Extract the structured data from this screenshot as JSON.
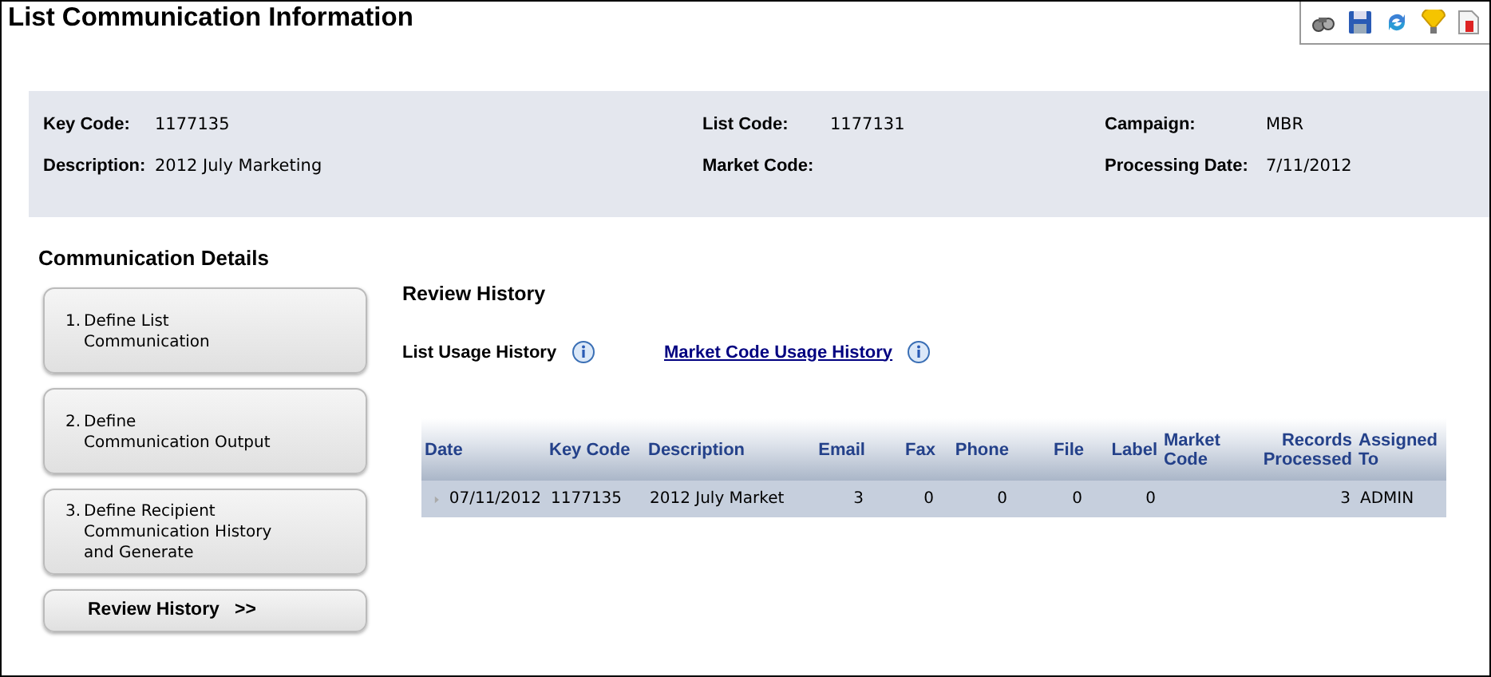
{
  "window": {
    "title": "List Communication Information"
  },
  "toolbar": [
    {
      "kind": "binoculars"
    },
    {
      "kind": "save"
    },
    {
      "kind": "refresh"
    },
    {
      "kind": "bulb"
    },
    {
      "kind": "report"
    }
  ],
  "info": [
    {
      "label": "Key Code:",
      "value": "1177135"
    },
    {
      "label": "List Code:",
      "value": "1177131"
    },
    {
      "label": "Campaign:",
      "value": "MBR"
    },
    {
      "label": "Description:",
      "value": "2012 July Marketing"
    },
    {
      "label": "Market Code:"
    },
    {
      "label": "Processing Date:",
      "value": "7/11/2012"
    }
  ],
  "section_title": "Communication Details",
  "steps": [
    {
      "number": "1.",
      "lines": [
        "Define List",
        "Communication"
      ],
      "selected": false
    },
    {
      "number": "2.",
      "lines": [
        "Define",
        "Communication Output"
      ],
      "selected": false
    },
    {
      "number": "3.",
      "lines": [
        "Define Recipient",
        "Communication History",
        "and Generate"
      ],
      "selected": false
    },
    {
      "label": "Review History   >>",
      "selected": true
    }
  ],
  "review": {
    "title": "Review History",
    "links": [
      {
        "label": "List Usage History",
        "kind": "label"
      },
      {
        "label": "Market Code Usage History",
        "kind": "link"
      }
    ],
    "table": {
      "columns": [
        {
          "label": "Date",
          "kind": "text"
        },
        {
          "label": "Key Code",
          "kind": "text"
        },
        {
          "label": "Description",
          "kind": "text"
        },
        {
          "label": "Email",
          "kind": "number"
        },
        {
          "label": "Fax",
          "kind": "number"
        },
        {
          "label": "Phone",
          "kind": "number"
        },
        {
          "label": "File",
          "kind": "number"
        },
        {
          "label": "Label",
          "kind": "number"
        },
        {
          "label": "Market Code",
          "kind": "text"
        },
        {
          "label": "Records Processed",
          "kind": "number"
        },
        {
          "label": "Assigned To",
          "kind": "text"
        }
      ],
      "rows": [
        {
          "expanded": false,
          "cells": [
            "07/11/2012",
            "1177135",
            "2012 July Market",
            "3",
            "0",
            "0",
            "0",
            "0",
            "",
            "3",
            "ADMIN"
          ]
        }
      ]
    }
  }
}
